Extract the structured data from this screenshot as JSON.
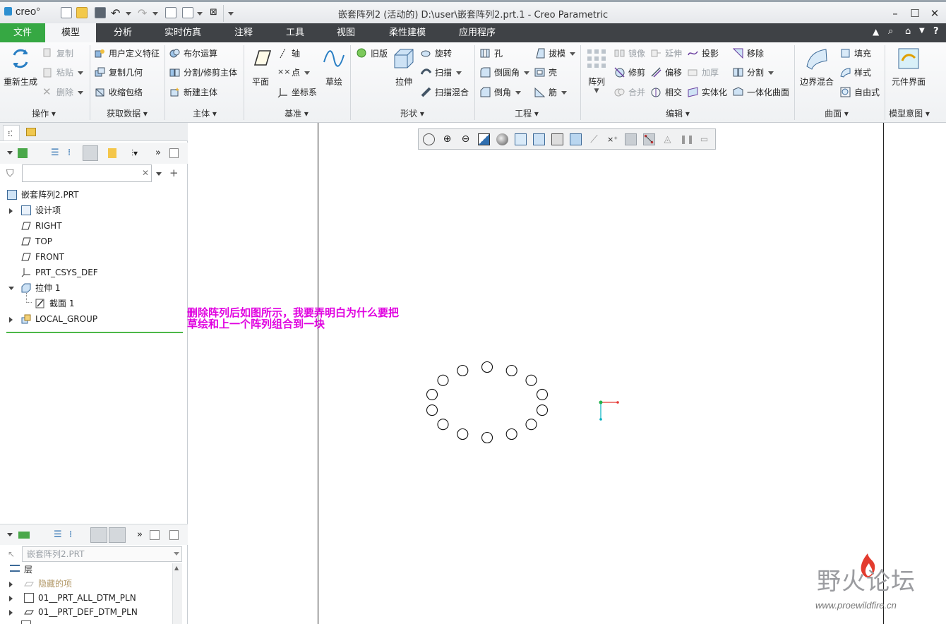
{
  "window": {
    "app_logo": "creo°",
    "title": "嵌套阵列2 (活动的) D:\\user\\嵌套阵列2.prt.1 - Creo Parametric",
    "controls": [
      "–",
      "☐",
      "✕"
    ]
  },
  "menu_tabs": [
    "文件",
    "模型",
    "分析",
    "实时仿真",
    "注释",
    "工具",
    "视图",
    "柔性建模",
    "应用程序"
  ],
  "ribbon": {
    "operations": {
      "regenerate": "重新生成",
      "copy": "复制",
      "paste": "粘贴",
      "delete": "删除",
      "label": "操作"
    },
    "get_data": {
      "udf": "用户定义特征",
      "copy_geom": "复制几何",
      "shrinkwrap": "收缩包络",
      "label": "获取数据"
    },
    "body": {
      "boolean": "布尔运算",
      "split_trim": "分割/修剪主体",
      "new_body": "新建主体",
      "label": "主体"
    },
    "datum": {
      "plane": "平面",
      "axis": "轴",
      "point": "点",
      "csys": "坐标系",
      "sketch": "草绘",
      "label": "基准"
    },
    "shapes": {
      "legacy": "旧版",
      "extrude": "拉伸",
      "revolve": "旋转",
      "sweep": "扫描",
      "swept_blend": "扫描混合",
      "label": "形状"
    },
    "engineering": {
      "hole": "孔",
      "round": "倒圆角",
      "chamfer": "倒角",
      "draft": "拔模",
      "shell": "壳",
      "rib": "筋",
      "label": "工程"
    },
    "editing": {
      "pattern": "阵列",
      "mirror": "镜像",
      "trim": "修剪",
      "merge": "合并",
      "extend": "延伸",
      "offset": "偏移",
      "intersect": "相交",
      "project": "投影",
      "thicken": "加厚",
      "solidify": "实体化",
      "remove": "移除",
      "split": "分割",
      "unify": "一体化曲面",
      "label": "编辑"
    },
    "surfaces": {
      "boundary_blend": "边界混合",
      "fill": "填充",
      "style": "样式",
      "freeform": "自由式",
      "label": "曲面"
    },
    "model_intent": {
      "component_interface": "元件界面",
      "label": "模型意图"
    }
  },
  "model_tree": {
    "root": "嵌套阵列2.PRT",
    "items": [
      {
        "label": "设计项"
      },
      {
        "label": "RIGHT"
      },
      {
        "label": "TOP"
      },
      {
        "label": "FRONT"
      },
      {
        "label": "PRT_CSYS_DEF"
      },
      {
        "label": "拉伸 1"
      },
      {
        "label": "截面 1"
      },
      {
        "label": "LOCAL_GROUP"
      }
    ],
    "filter_placeholder": ""
  },
  "layer_tree": {
    "selected_model": "嵌套阵列2.PRT",
    "root": "层",
    "items": [
      {
        "label": "隐藏的项"
      },
      {
        "label": "01__PRT_ALL_DTM_PLN"
      },
      {
        "label": "01__PRT_DEF_DTM_PLN"
      }
    ]
  },
  "annotation": {
    "line1": "删除阵列后如图所示，我要弄明白为什么要把",
    "line2": "草绘和上一个阵列组合到一块"
  },
  "pattern_preview": {
    "hole_count": 14
  },
  "watermark": {
    "text": "野火论坛",
    "url": "www.proewildfire.cn"
  },
  "colors": {
    "file_tab": "#36a843",
    "tab_bar": "#3f4246",
    "annotation": "#e000e0",
    "csys_x": "#e53935",
    "csys_y": "#00b0c0",
    "csys_origin": "#22b24c"
  }
}
